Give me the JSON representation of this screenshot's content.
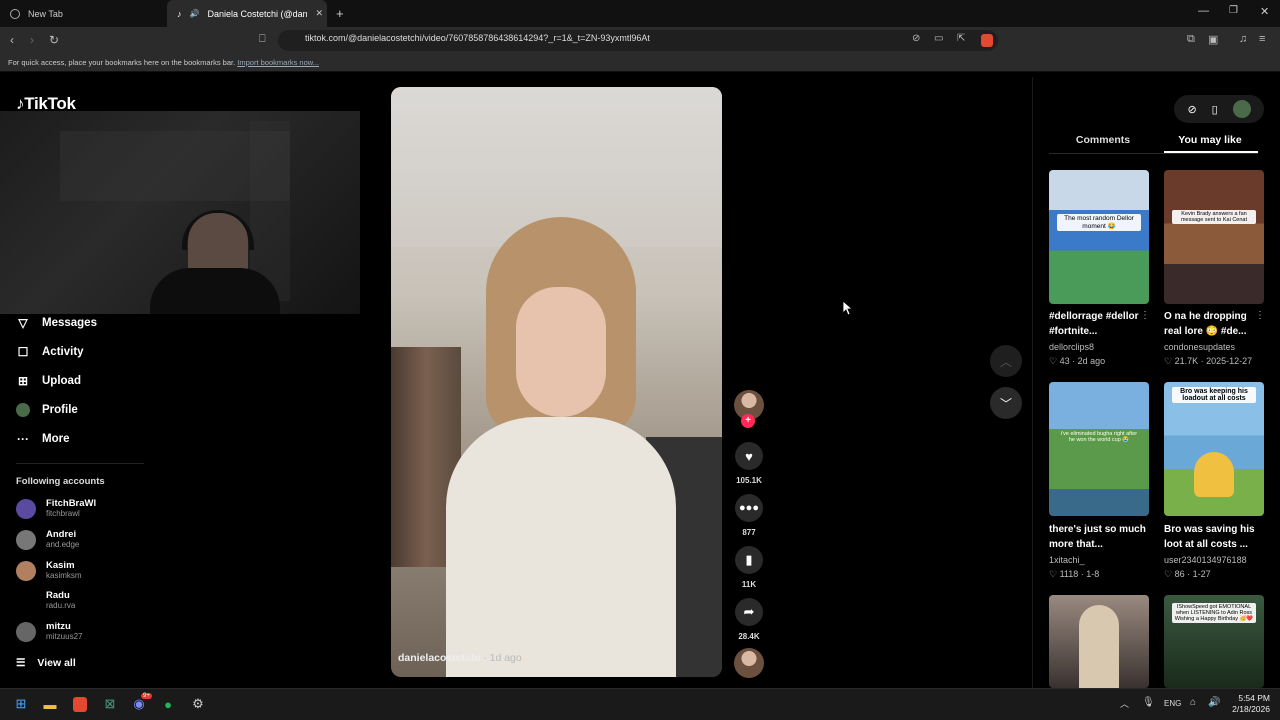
{
  "browser": {
    "tabs": [
      {
        "label": "New Tab"
      },
      {
        "label": "Daniela Costetchi (@daniela"
      }
    ],
    "url": "tiktok.com/@danielacostetchi/video/7607858786438614294?_r=1&_t=ZN-93yxmtl96At",
    "bookmarks_text": "For quick access, place your bookmarks here on the bookmarks bar.",
    "bookmarks_link": "Import bookmarks now..."
  },
  "sidebar": {
    "logo": "TikTok",
    "menu": [
      {
        "label": "Messages",
        "icon": "send-icon"
      },
      {
        "label": "Activity",
        "icon": "inbox-icon"
      },
      {
        "label": "Upload",
        "icon": "plus-square-icon"
      },
      {
        "label": "Profile",
        "icon": "avatar-icon"
      },
      {
        "label": "More",
        "icon": "more-dots-icon"
      }
    ],
    "following_title": "Following accounts",
    "accounts": [
      {
        "name": "FitchBraWl",
        "handle": "fitchbrawl",
        "color": "#5a4aa0"
      },
      {
        "name": "Andrei",
        "handle": "and.edge",
        "color": "#777777"
      },
      {
        "name": "Kasim",
        "handle": "kasimksm",
        "color": "#b08060"
      },
      {
        "name": "Radu",
        "handle": "radu.rva",
        "color": "#000000"
      },
      {
        "name": "mitzu",
        "handle": "mitzuus27",
        "color": "#666666"
      }
    ],
    "view_all": "View all"
  },
  "video": {
    "author": "danielacostetchi",
    "time": " · 1d ago",
    "likes": "105.1K",
    "comments": "877",
    "saves": "11K",
    "shares": "28.4K"
  },
  "right_panel": {
    "tabs": [
      "Comments",
      "You may like"
    ],
    "active_tab": "You may like",
    "items": [
      {
        "caption": "#dellorrage #dellor #fortnite...",
        "user": "dellorclips8",
        "likes": "43",
        "date": "2d ago",
        "overlay": "The most random Dellor moment 😂",
        "bg": "#3a7ac8"
      },
      {
        "caption": "O na he dropping real lore 😳 #de...",
        "user": "condonesupdates",
        "likes": "21.7K",
        "date": "2025-12-27",
        "overlay": "Kevin Brady answers a fan message sent to Kai Cenat",
        "bg": "#8a5a3a"
      },
      {
        "caption": "there's just so much more that...",
        "user": "1xitachi_",
        "likes": "1118",
        "date": "1-8",
        "overlay": "i've eliminated bugha right after he won the world cup 😭",
        "bg": "#5a9a4a"
      },
      {
        "caption": "Bro was saving his loot at all costs ...",
        "user": "user2340134976188",
        "likes": "86",
        "date": "1-27",
        "overlay": "Bro was keeping his loadout at all costs",
        "bg": "#6aa8d8"
      },
      {
        "caption": "",
        "user": "",
        "likes": "",
        "date": "",
        "overlay": "",
        "bg": "#6a5a50"
      },
      {
        "caption": "",
        "user": "",
        "likes": "",
        "date": "",
        "overlay": "IShowSpeed got EMOTIONAL when LISTENING to Adin Ross Wishing a Happy Birthday 🥳❤️",
        "bg": "#2a4a30"
      }
    ]
  },
  "taskbar": {
    "lang": "ENG",
    "time": "5:54 PM",
    "date": "2/18/2026",
    "discord_badge": "9+"
  }
}
